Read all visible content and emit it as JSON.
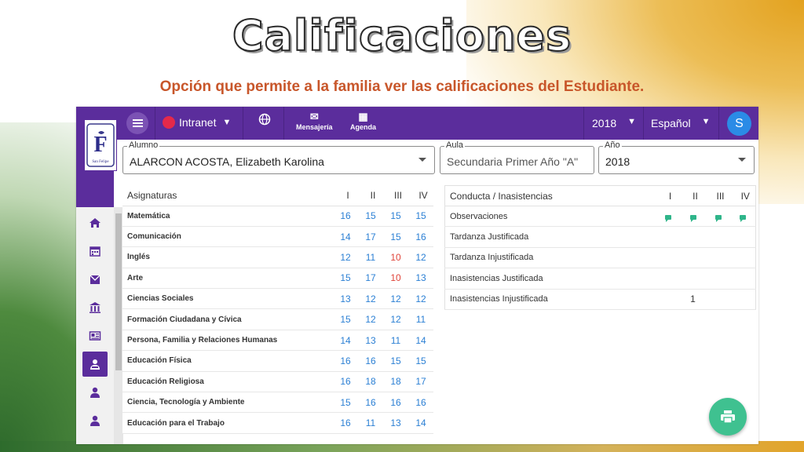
{
  "slide": {
    "title": "Calificaciones",
    "subtitle": "Opción que permite a la familia ver las calificaciones del Estudiante."
  },
  "topbar": {
    "menu_icon": "hamburger-menu-icon",
    "app_name": "Intranet",
    "globe_icon": "globe-icon",
    "messaging_label": "Mensajería",
    "agenda_label": "Agenda",
    "year": "2018",
    "language": "Español",
    "avatar_initial": "S"
  },
  "logo": {
    "letter": "F",
    "caption": "San Felipe"
  },
  "sidebar": {
    "icons": [
      "home-icon",
      "calendar-icon",
      "mail-icon",
      "institution-icon",
      "newspaper-icon",
      "student-icon",
      "person-icon",
      "person-icon"
    ],
    "active_index": 5
  },
  "filters": {
    "student_label": "Alumno",
    "student_value": "ALARCON ACOSTA, Elizabeth Karolina",
    "classroom_label": "Aula",
    "classroom_value": "Secundaria Primer Año \"A\"",
    "year_label": "Año",
    "year_value": "2018"
  },
  "grades": {
    "header": "Asignaturas",
    "periods": [
      "I",
      "II",
      "III",
      "IV"
    ],
    "rows": [
      {
        "subject": "Matemática",
        "scores": [
          "16",
          "15",
          "15",
          "15"
        ]
      },
      {
        "subject": "Comunicación",
        "scores": [
          "14",
          "17",
          "15",
          "16"
        ]
      },
      {
        "subject": "Inglés",
        "scores": [
          "12",
          "11",
          "10",
          "12"
        ]
      },
      {
        "subject": "Arte",
        "scores": [
          "15",
          "17",
          "10",
          "13"
        ]
      },
      {
        "subject": "Ciencias Sociales",
        "scores": [
          "13",
          "12",
          "12",
          "12"
        ]
      },
      {
        "subject": "Formación Ciudadana y Cívica",
        "scores": [
          "15",
          "12",
          "12",
          "11"
        ]
      },
      {
        "subject": "Persona, Familia y Relaciones Humanas",
        "scores": [
          "14",
          "13",
          "11",
          "14"
        ]
      },
      {
        "subject": "Educación Física",
        "scores": [
          "16",
          "16",
          "15",
          "15"
        ]
      },
      {
        "subject": "Educación Religiosa",
        "scores": [
          "16",
          "18",
          "18",
          "17"
        ]
      },
      {
        "subject": "Ciencia, Tecnología y Ambiente",
        "scores": [
          "15",
          "16",
          "16",
          "16"
        ]
      },
      {
        "subject": "Educación para el Trabajo",
        "scores": [
          "16",
          "11",
          "13",
          "14"
        ]
      }
    ]
  },
  "conduct": {
    "header": "Conducta / Inasistencias",
    "periods": [
      "I",
      "II",
      "III",
      "IV"
    ],
    "rows": [
      {
        "item": "Observaciones",
        "values": [
          "chat-icon",
          "chat-icon",
          "chat-icon",
          "chat-icon"
        ]
      },
      {
        "item": "Tardanza Justificada",
        "values": [
          "",
          "",
          "",
          ""
        ]
      },
      {
        "item": "Tardanza Injustificada",
        "values": [
          "",
          "",
          "",
          ""
        ]
      },
      {
        "item": "Inasistencias Justificada",
        "values": [
          "",
          "",
          "",
          ""
        ]
      },
      {
        "item": "Inasistencias Injustificada",
        "values": [
          "",
          "1",
          "",
          ""
        ]
      }
    ]
  },
  "print_button": {
    "icon": "printer-icon"
  },
  "colors": {
    "primary": "#5b2d9c",
    "grade": "#2a7fd4",
    "failing": "#e0443a",
    "accent": "#3fc190"
  }
}
